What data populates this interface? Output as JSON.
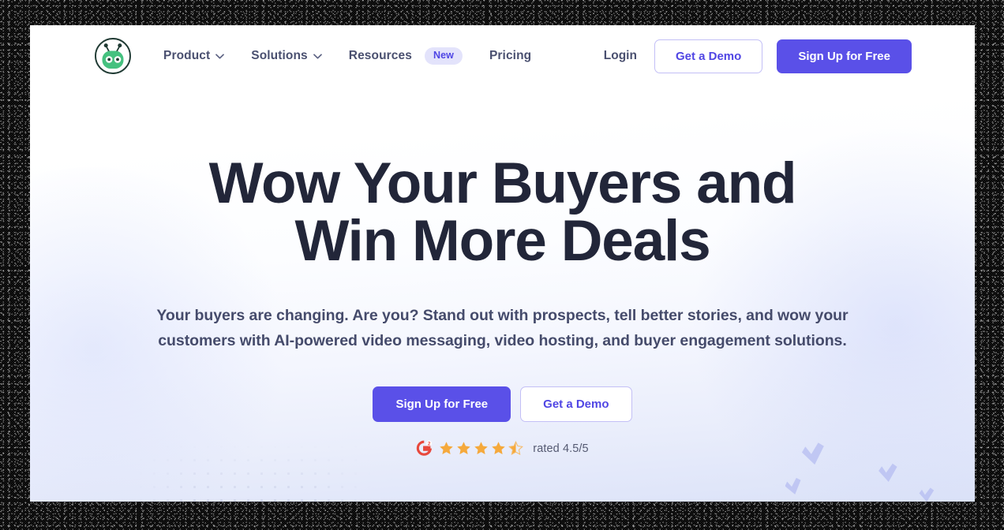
{
  "brand": {
    "logo_icon": "vidyard-robot-logo",
    "logo_green": "#45c17f",
    "accent_indigo": "#5a50e8",
    "headline_navy": "#222639",
    "star_orange": "#f5a93c",
    "g2_red": "#e8483c"
  },
  "nav": {
    "links": [
      {
        "label": "Product",
        "has_dropdown": true,
        "badge": null
      },
      {
        "label": "Solutions",
        "has_dropdown": true,
        "badge": null
      },
      {
        "label": "Resources",
        "has_dropdown": false,
        "badge": "New"
      },
      {
        "label": "Pricing",
        "has_dropdown": false,
        "badge": null
      }
    ],
    "login_label": "Login",
    "demo_label": "Get a Demo",
    "signup_label": "Sign Up for Free"
  },
  "hero": {
    "headline": "Wow Your Buyers and Win More Deals",
    "subheadline": "Your buyers are changing. Are you? Stand out with prospects, tell better stories, and wow your customers with AI-powered video messaging, video hosting, and buyer engagement solutions.",
    "primary_cta": "Sign Up for Free",
    "secondary_cta": "Get a Demo"
  },
  "rating": {
    "source_icon": "g2-logo",
    "stars_filled": 4,
    "stars_half": 1,
    "stars_total": 5,
    "text": "rated 4.5/5",
    "score": "4.5",
    "out_of": "5"
  },
  "decor": {
    "dot_pattern": "triangular-dot-grid",
    "confetti": "check-mark-shapes"
  }
}
